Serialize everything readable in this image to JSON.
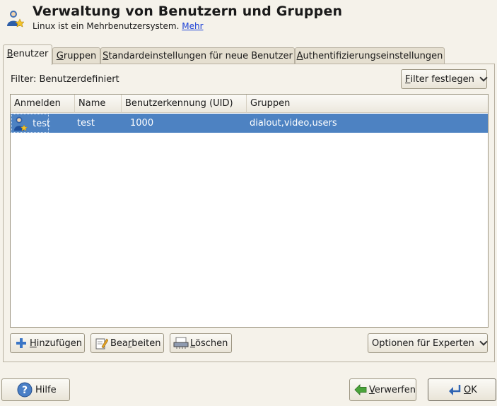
{
  "header": {
    "title": "Verwaltung von Benutzern und Gruppen",
    "subtitle": "Linux ist ein Mehrbenutzersystem.",
    "link": "Mehr"
  },
  "tabs": [
    {
      "label": "Benutzer",
      "mnemonic": "B",
      "rest": "enutzer",
      "active": true
    },
    {
      "label": "Gruppen",
      "mnemonic": "G",
      "rest": "ruppen",
      "active": false
    },
    {
      "label": "Standardeinstellungen für neue Benutzer",
      "mnemonic": "S",
      "rest": "tandardeinstellungen für neue Benutzer",
      "active": false
    },
    {
      "label": "Authentifizierungseinstellungen",
      "mnemonic": "A",
      "rest": "uthentifizierungseinstellungen",
      "active": false
    }
  ],
  "filter": {
    "label": "Filter: Benutzerdefiniert",
    "button_mn": "F",
    "button_rest": "ilter festlegen"
  },
  "table": {
    "columns": [
      "Anmelden",
      "Name",
      "Benutzerkennung (UID)",
      "Gruppen"
    ],
    "rows": [
      {
        "login": "test",
        "name": "test",
        "uid": "1000",
        "groups": "dialout,video,users",
        "selected": true
      }
    ]
  },
  "actions": {
    "add": {
      "pre": "",
      "mn": "H",
      "post": "inzufügen"
    },
    "edit": {
      "pre": "Bea",
      "mn": "r",
      "post": "beiten"
    },
    "delete": {
      "pre": "",
      "mn": "L",
      "post": "öschen"
    },
    "expert": {
      "label": "Optionen für Experten"
    }
  },
  "footer": {
    "help": "Hilfe",
    "discard": {
      "pre": "",
      "mn": "V",
      "post": "erwerfen"
    },
    "ok": {
      "pre": "",
      "mn": "O",
      "post": "K"
    }
  },
  "colors": {
    "selection": "#4d82c2",
    "background": "#f5f2ea",
    "link": "#1a3fd6"
  }
}
